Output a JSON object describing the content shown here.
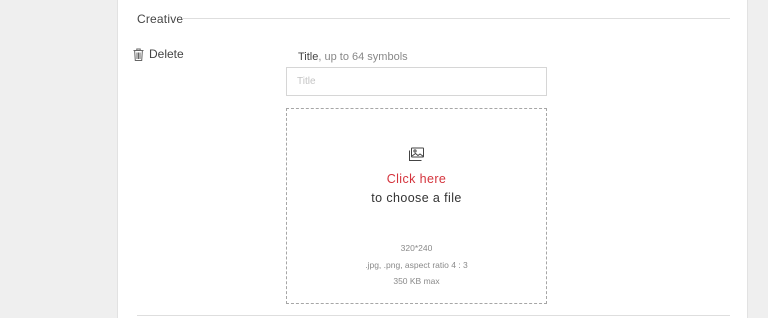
{
  "section": {
    "title": "Creative"
  },
  "delete": {
    "label": "Delete",
    "icon": "trash-icon"
  },
  "title_field": {
    "label_strong": "Title",
    "label_hint": ", up to 64 symbols",
    "placeholder": "Title",
    "value": ""
  },
  "upload": {
    "icon": "image-icon",
    "click_text": "Click here",
    "choose_text": "to choose a file",
    "dimensions": "320*240",
    "formats": ".jpg, .png, aspect ratio 4 : 3",
    "max_size": "350 KB max",
    "accent_color": "#d4333c"
  }
}
